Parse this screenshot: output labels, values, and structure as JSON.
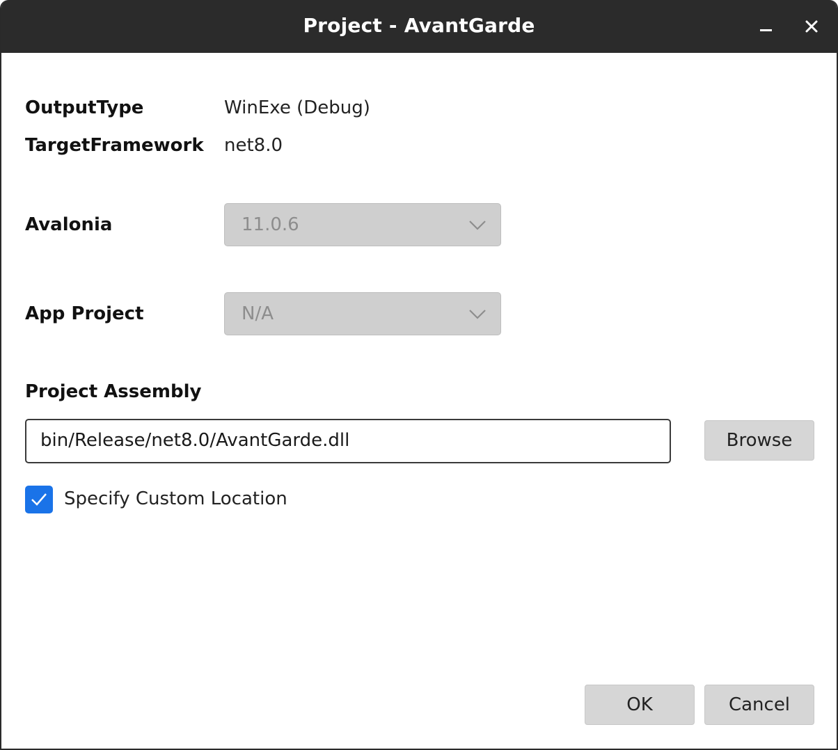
{
  "window": {
    "title": "Project - AvantGarde"
  },
  "info": {
    "output_type_label": "OutputType",
    "output_type_value": "WinExe (Debug)",
    "target_framework_label": "TargetFramework",
    "target_framework_value": "net8.0"
  },
  "avalonia": {
    "label": "Avalonia",
    "selected": "11.0.6"
  },
  "app_project": {
    "label": "App Project",
    "selected": "N/A"
  },
  "assembly": {
    "label": "Project Assembly",
    "value": "bin/Release/net8.0/AvantGarde.dll",
    "browse_label": "Browse"
  },
  "custom_location": {
    "label": "Specify Custom Location",
    "checked": true
  },
  "footer": {
    "ok_label": "OK",
    "cancel_label": "Cancel"
  },
  "colors": {
    "titlebar": "#2b2b2b",
    "checkbox_accent": "#1a73e8",
    "disabled_combo": "#cfcfcf",
    "button": "#d6d6d6"
  },
  "icons": {
    "minimize": "minimize-icon",
    "close": "close-icon",
    "dropdown": "chevron-down-icon",
    "check": "check-icon"
  }
}
